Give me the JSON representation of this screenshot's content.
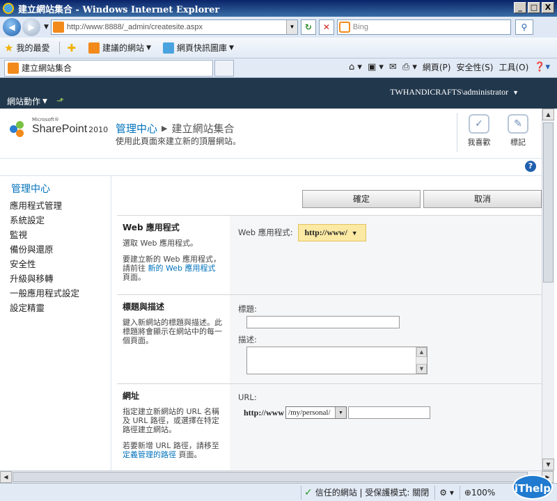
{
  "window": {
    "title": "建立網站集合 - Windows Internet Explorer",
    "controls": {
      "minimize": "_",
      "maximize": "□",
      "close": "X"
    }
  },
  "address_bar": {
    "url": "http://www:8888/_admin/createsite.aspx",
    "search_placeholder": "Bing"
  },
  "favorites_bar": {
    "favorites_label": "我的最愛",
    "suggested_sites": "建議的網站",
    "web_slice_gallery": "網頁快訊圖庫"
  },
  "tab": {
    "title": "建立網站集合"
  },
  "command_bar": {
    "page": "網頁(P)",
    "safety": "安全性(S)",
    "tools": "工具(O)"
  },
  "sharepoint": {
    "site_actions": "網站動作",
    "user": "TWHANDICRAFTS\\administrator",
    "logo_ms": "Microsoft®",
    "logo_text": "SharePoint",
    "logo_version": "2010",
    "breadcrumb_root": "管理中心",
    "breadcrumb_current": "建立網站集合",
    "page_description": "使用此頁面來建立新的頂層網站。",
    "i_like_it": "我喜歡",
    "tags_notes": "標記"
  },
  "left_nav": {
    "heading": "管理中心",
    "items": [
      "應用程式管理",
      "系統設定",
      "監視",
      "備份與還原",
      "安全性",
      "升級與移轉",
      "一般應用程式設定",
      "設定精靈"
    ]
  },
  "buttons": {
    "ok": "確定",
    "cancel": "取消"
  },
  "sections": {
    "web_app": {
      "title": "Web 應用程式",
      "text1": "選取 Web 應用程式。",
      "text2_pre": "要建立新的 Web 應用程式，請前往",
      "text2_link": "新的 Web 應用程式",
      "text2_post": "頁面。",
      "field_label": "Web 應用程式:",
      "selected": "http://www/"
    },
    "title_desc": {
      "title": "標題與描述",
      "text": "鍵入新網站的標題與描述。此標題將會顯示在網站中的每一個頁面。",
      "title_label": "標題:",
      "desc_label": "描述:"
    },
    "url": {
      "title": "網址",
      "text1": "指定建立新網站的 URL 名稱及 URL 路徑，或選擇在特定路徑建立網站。",
      "text2_pre": "若要新增 URL 路徑，請移至",
      "text2_link": "定義管理的路徑",
      "text2_post": "頁面。",
      "url_label": "URL:",
      "prefix": "http://www",
      "path": "/my/personal/"
    }
  },
  "status_bar": {
    "trusted": "信任的網站 | 受保護模式: 關閉",
    "zoom": "100%"
  },
  "watermark": "iThelp"
}
